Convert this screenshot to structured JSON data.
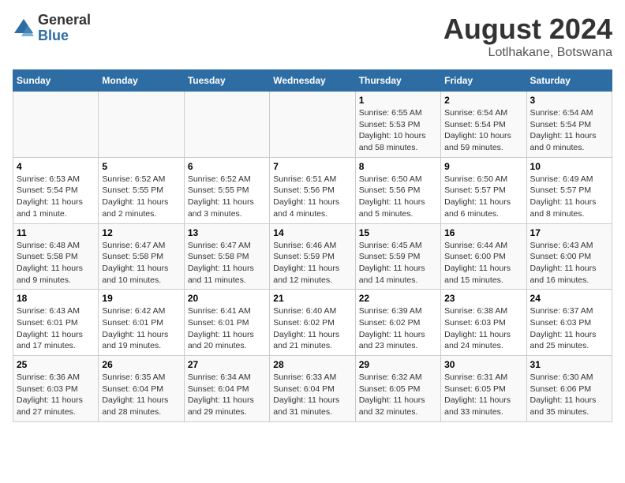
{
  "header": {
    "logo_general": "General",
    "logo_blue": "Blue",
    "title": "August 2024",
    "subtitle": "Lotlhakane, Botswana"
  },
  "calendar": {
    "days_of_week": [
      "Sunday",
      "Monday",
      "Tuesday",
      "Wednesday",
      "Thursday",
      "Friday",
      "Saturday"
    ],
    "weeks": [
      [
        {
          "day": "",
          "info": ""
        },
        {
          "day": "",
          "info": ""
        },
        {
          "day": "",
          "info": ""
        },
        {
          "day": "",
          "info": ""
        },
        {
          "day": "1",
          "info": "Sunrise: 6:55 AM\nSunset: 5:53 PM\nDaylight: 10 hours and 58 minutes."
        },
        {
          "day": "2",
          "info": "Sunrise: 6:54 AM\nSunset: 5:54 PM\nDaylight: 10 hours and 59 minutes."
        },
        {
          "day": "3",
          "info": "Sunrise: 6:54 AM\nSunset: 5:54 PM\nDaylight: 11 hours and 0 minutes."
        }
      ],
      [
        {
          "day": "4",
          "info": "Sunrise: 6:53 AM\nSunset: 5:54 PM\nDaylight: 11 hours and 1 minute."
        },
        {
          "day": "5",
          "info": "Sunrise: 6:52 AM\nSunset: 5:55 PM\nDaylight: 11 hours and 2 minutes."
        },
        {
          "day": "6",
          "info": "Sunrise: 6:52 AM\nSunset: 5:55 PM\nDaylight: 11 hours and 3 minutes."
        },
        {
          "day": "7",
          "info": "Sunrise: 6:51 AM\nSunset: 5:56 PM\nDaylight: 11 hours and 4 minutes."
        },
        {
          "day": "8",
          "info": "Sunrise: 6:50 AM\nSunset: 5:56 PM\nDaylight: 11 hours and 5 minutes."
        },
        {
          "day": "9",
          "info": "Sunrise: 6:50 AM\nSunset: 5:57 PM\nDaylight: 11 hours and 6 minutes."
        },
        {
          "day": "10",
          "info": "Sunrise: 6:49 AM\nSunset: 5:57 PM\nDaylight: 11 hours and 8 minutes."
        }
      ],
      [
        {
          "day": "11",
          "info": "Sunrise: 6:48 AM\nSunset: 5:58 PM\nDaylight: 11 hours and 9 minutes."
        },
        {
          "day": "12",
          "info": "Sunrise: 6:47 AM\nSunset: 5:58 PM\nDaylight: 11 hours and 10 minutes."
        },
        {
          "day": "13",
          "info": "Sunrise: 6:47 AM\nSunset: 5:58 PM\nDaylight: 11 hours and 11 minutes."
        },
        {
          "day": "14",
          "info": "Sunrise: 6:46 AM\nSunset: 5:59 PM\nDaylight: 11 hours and 12 minutes."
        },
        {
          "day": "15",
          "info": "Sunrise: 6:45 AM\nSunset: 5:59 PM\nDaylight: 11 hours and 14 minutes."
        },
        {
          "day": "16",
          "info": "Sunrise: 6:44 AM\nSunset: 6:00 PM\nDaylight: 11 hours and 15 minutes."
        },
        {
          "day": "17",
          "info": "Sunrise: 6:43 AM\nSunset: 6:00 PM\nDaylight: 11 hours and 16 minutes."
        }
      ],
      [
        {
          "day": "18",
          "info": "Sunrise: 6:43 AM\nSunset: 6:01 PM\nDaylight: 11 hours and 17 minutes."
        },
        {
          "day": "19",
          "info": "Sunrise: 6:42 AM\nSunset: 6:01 PM\nDaylight: 11 hours and 19 minutes."
        },
        {
          "day": "20",
          "info": "Sunrise: 6:41 AM\nSunset: 6:01 PM\nDaylight: 11 hours and 20 minutes."
        },
        {
          "day": "21",
          "info": "Sunrise: 6:40 AM\nSunset: 6:02 PM\nDaylight: 11 hours and 21 minutes."
        },
        {
          "day": "22",
          "info": "Sunrise: 6:39 AM\nSunset: 6:02 PM\nDaylight: 11 hours and 23 minutes."
        },
        {
          "day": "23",
          "info": "Sunrise: 6:38 AM\nSunset: 6:03 PM\nDaylight: 11 hours and 24 minutes."
        },
        {
          "day": "24",
          "info": "Sunrise: 6:37 AM\nSunset: 6:03 PM\nDaylight: 11 hours and 25 minutes."
        }
      ],
      [
        {
          "day": "25",
          "info": "Sunrise: 6:36 AM\nSunset: 6:03 PM\nDaylight: 11 hours and 27 minutes."
        },
        {
          "day": "26",
          "info": "Sunrise: 6:35 AM\nSunset: 6:04 PM\nDaylight: 11 hours and 28 minutes."
        },
        {
          "day": "27",
          "info": "Sunrise: 6:34 AM\nSunset: 6:04 PM\nDaylight: 11 hours and 29 minutes."
        },
        {
          "day": "28",
          "info": "Sunrise: 6:33 AM\nSunset: 6:04 PM\nDaylight: 11 hours and 31 minutes."
        },
        {
          "day": "29",
          "info": "Sunrise: 6:32 AM\nSunset: 6:05 PM\nDaylight: 11 hours and 32 minutes."
        },
        {
          "day": "30",
          "info": "Sunrise: 6:31 AM\nSunset: 6:05 PM\nDaylight: 11 hours and 33 minutes."
        },
        {
          "day": "31",
          "info": "Sunrise: 6:30 AM\nSunset: 6:06 PM\nDaylight: 11 hours and 35 minutes."
        }
      ]
    ]
  }
}
